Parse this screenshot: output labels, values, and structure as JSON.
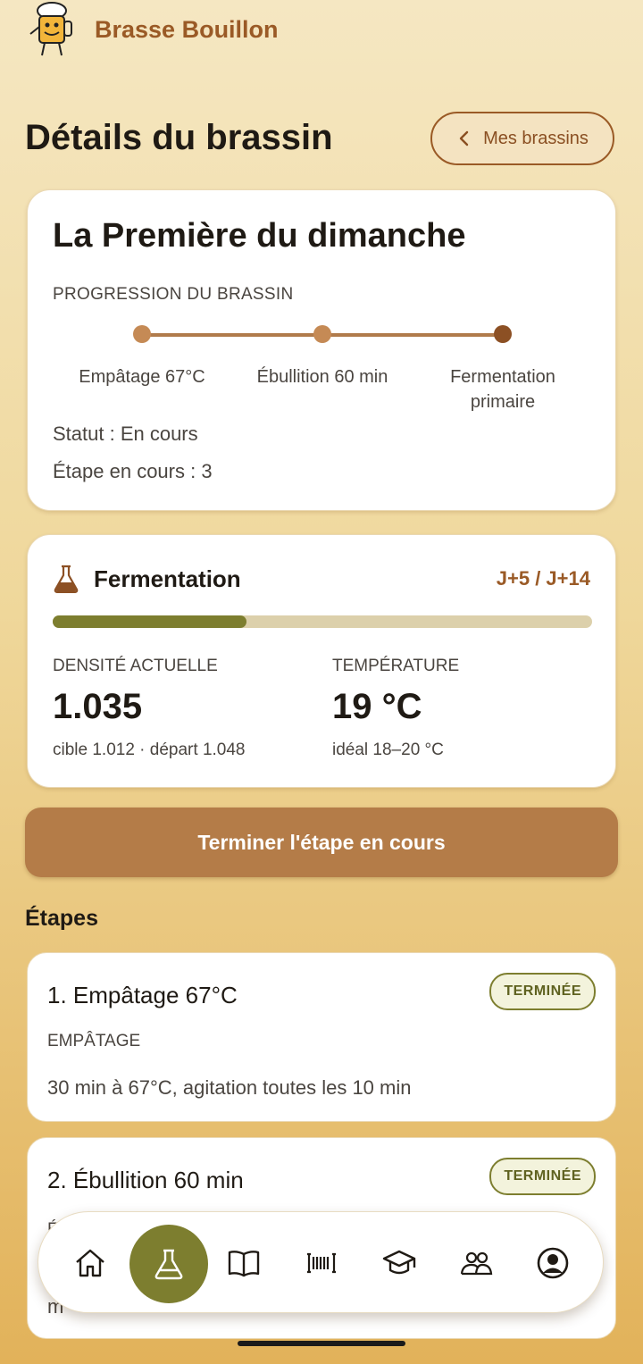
{
  "app": {
    "name": "Brasse Bouillon"
  },
  "page": {
    "title": "Détails du brassin",
    "back_label": "Mes brassins"
  },
  "brew": {
    "name": "La Première du dimanche",
    "progress_label": "PROGRESSION DU BRASSIN",
    "steps": [
      {
        "label": "Empâtage 67°C"
      },
      {
        "label": "Ébullition 60 min"
      },
      {
        "label": "Fermentation primaire"
      }
    ],
    "status": "Statut : En cours",
    "current_step": "Étape en cours : 3"
  },
  "fermentation": {
    "title": "Fermentation",
    "days": "J+5 / J+14",
    "progress_fraction": 0.36,
    "density": {
      "label": "DENSITÉ ACTUELLE",
      "value": "1.035",
      "sub": "cible 1.012 · départ 1.048"
    },
    "temperature": {
      "label": "TEMPÉRATURE",
      "value": "19 °C",
      "sub": "idéal 18–20 °C"
    }
  },
  "actions": {
    "finish_step": "Terminer l'étape en cours"
  },
  "steps_section": {
    "title": "Étapes",
    "items": [
      {
        "title": "1. Empâtage 67°C",
        "type": "EMPÂTAGE",
        "desc": "30 min à 67°C, agitation toutes les 10 min",
        "badge": "TERMINÉE"
      },
      {
        "title": "2. Ébullition 60 min",
        "type": "É",
        "desc": "m",
        "badge": "TERMINÉE"
      }
    ]
  },
  "nav": {
    "items": [
      "home-icon",
      "flask-icon",
      "book-icon",
      "barcode-icon",
      "graduation-cap-icon",
      "community-icon",
      "profile-icon"
    ],
    "active": "flask-icon"
  },
  "colors": {
    "brand": "#9a5a26",
    "accent": "#7d7e2f",
    "button": "#b47c48"
  }
}
